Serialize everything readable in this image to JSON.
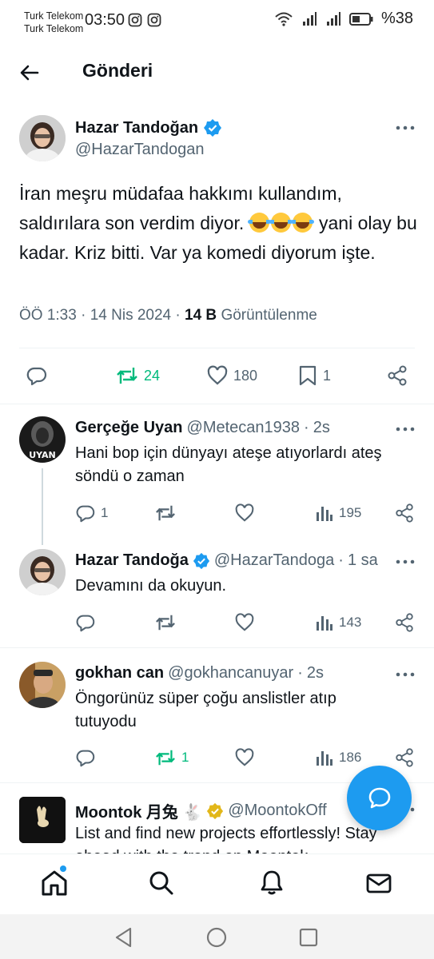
{
  "status_bar": {
    "carrier1": "Turk Telekom",
    "carrier2": "Turk Telekom",
    "time": "03:50",
    "battery": "%38"
  },
  "header": {
    "title": "Gönderi"
  },
  "main_tweet": {
    "name": "Hazar Tandoğan",
    "handle": "@HazarTandogan",
    "text_part1": "İran meşru müdafaa hakkımı kullandım, saldırılara son verdim diyor.",
    "text_part2": "yani olay bu kadar. Kriz bitti. Var ya komedi diyorum işte.",
    "time": "ÖÖ 1:33",
    "date": "14 Nis 2024",
    "views_count": "14 B",
    "views_label": "Görüntülenme",
    "retweets": "24",
    "likes": "180",
    "bookmarks": "1"
  },
  "replies": [
    {
      "name": "Gerçeğe Uyan",
      "handle": "@Metecan1938",
      "time": "2s",
      "text": "Hani bop için dünyayı ateşe atıyorlardı ateş söndü o zaman",
      "replies": "1",
      "retweets": "",
      "views": "195",
      "avatar_text": "UYAN"
    },
    {
      "name": "Hazar Tandoğa",
      "handle": "@HazarTandoga",
      "time": "1 sa",
      "text": "Devamını da okuyun.",
      "replies": "",
      "retweets": "",
      "views": "143"
    },
    {
      "name": "gokhan can",
      "handle": "@gokhancanuyar",
      "time": "2s",
      "text": "Öngorünüz süper çoğu anslistler atıp tutuyodu",
      "replies": "",
      "retweets": "1",
      "views": "186"
    },
    {
      "name": "Moontok 月兔 🐇",
      "handle": "@MoontokOff",
      "text": "List and find new projects effortlessly! Stay ahead with the trend on Moontok"
    }
  ],
  "colors": {
    "accent": "#1d9bf0",
    "retweet_green": "#00ba7c",
    "gold_check": "#e2b719"
  },
  "icons": [
    "back-arrow-icon",
    "verified-badge-icon",
    "more-icon",
    "reply-icon",
    "retweet-icon",
    "like-icon",
    "bookmark-icon",
    "share-icon",
    "views-icon",
    "compose-icon",
    "home-icon",
    "search-icon",
    "notifications-icon",
    "messages-icon"
  ]
}
